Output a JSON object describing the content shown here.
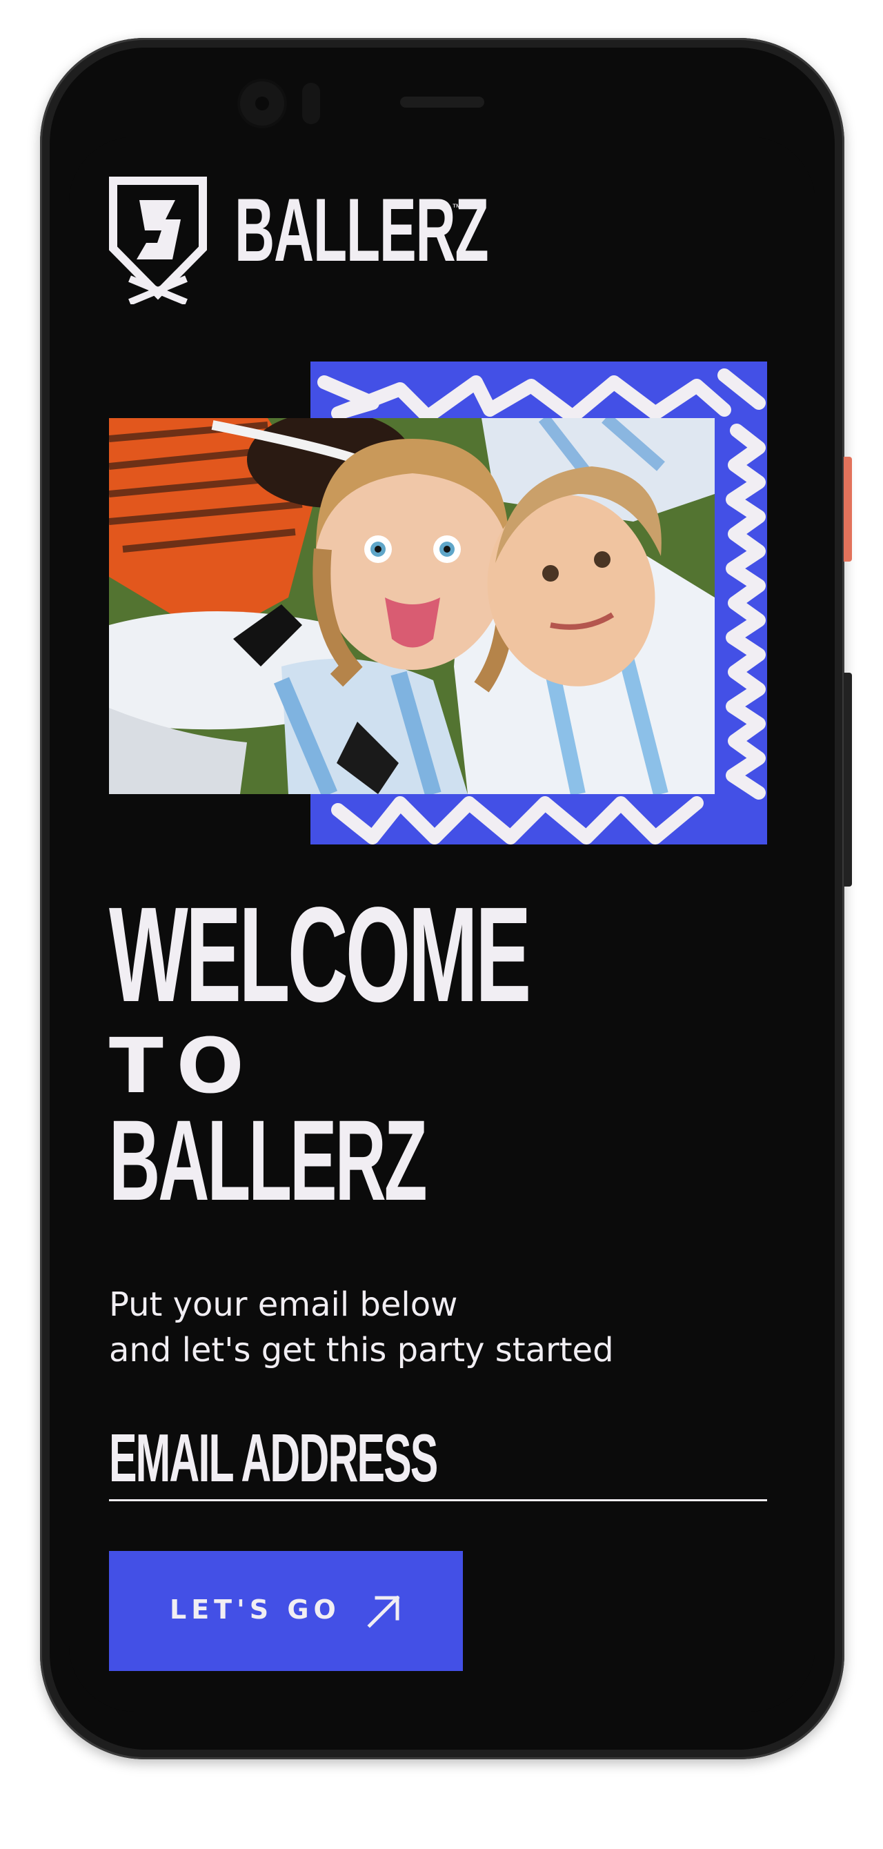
{
  "brand": {
    "name": "BALLERZ",
    "trademark": "™",
    "logo_icon": "shield-b-logo-icon"
  },
  "hero": {
    "image": "photo of smiling girls soccer team huddle",
    "accent_color": "#4350e6"
  },
  "headline": {
    "line1": "WELCOME",
    "line2": "TO",
    "line3": "BALLERZ"
  },
  "subtitle": {
    "line1": "Put your email below",
    "line2": "and let's get this party started"
  },
  "form": {
    "email_label": "EMAIL ADDRESS",
    "email_value": "",
    "email_placeholder": "EMAIL ADDRESS"
  },
  "cta": {
    "label": "LET'S GO",
    "icon": "arrow-up-right-icon"
  },
  "colors": {
    "background": "#0b0b0b",
    "text": "#f1eef3",
    "accent": "#4350e6"
  }
}
